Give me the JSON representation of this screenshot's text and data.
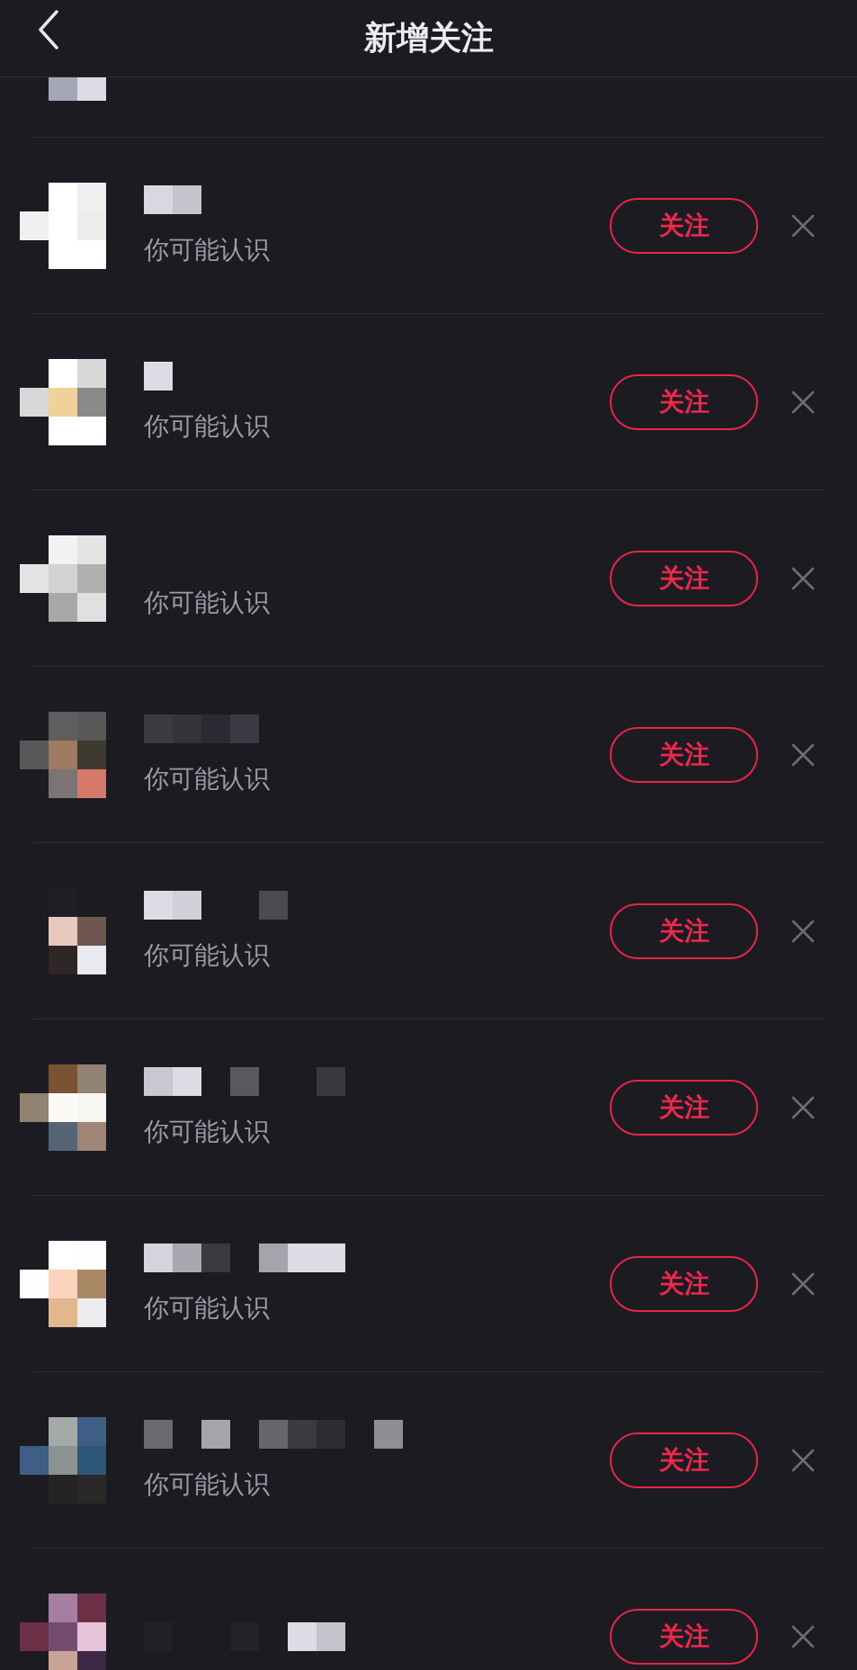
{
  "header": {
    "title": "新增关注"
  },
  "suggestions": [
    {
      "partial": true
    },
    {
      "subtitle": "你可能认识",
      "button": "关注"
    },
    {
      "subtitle": "你可能认识",
      "button": "关注"
    },
    {
      "subtitle": "你可能认识",
      "button": "关注"
    },
    {
      "subtitle": "你可能认识",
      "button": "关注"
    },
    {
      "subtitle": "你可能认识",
      "button": "关注"
    },
    {
      "subtitle": "你可能认识",
      "button": "关注"
    },
    {
      "subtitle": "你可能认识",
      "button": "关注"
    },
    {
      "subtitle": "你可能认识",
      "button": "关注"
    },
    {
      "button": "关注"
    }
  ]
}
